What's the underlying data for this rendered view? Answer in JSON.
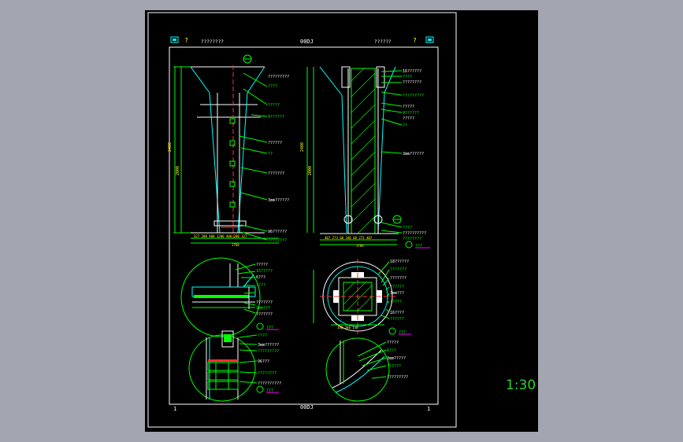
{
  "drawing": {
    "header_left_label": "????????",
    "header_code_top": "00DJ",
    "header_right_label": "??????",
    "header_q_left": "?",
    "header_q_right": "?",
    "footer_code": "00DJ",
    "footer_left_num": "1",
    "footer_right_num": "1",
    "scale": "1:30",
    "views": [
      {
        "name": "front-elevation",
        "callouts": [
          "?????????",
          "????",
          "?????",
          "9??????",
          "??????",
          "??",
          "???????",
          "3mm??????",
          "96??????",
          "????????"
        ]
      },
      {
        "name": "section-elevation",
        "callouts": [
          "16??????",
          "????",
          "????????",
          "?????????",
          "?????",
          "9??????",
          "?????",
          "??",
          "3mm??????",
          "????",
          "??????????",
          "????????"
        ]
      },
      {
        "name": "detail-1",
        "callouts": [
          "?????",
          "15?????",
          "6???",
          "????",
          "???????",
          "3mm???",
          "???????"
        ]
      },
      {
        "name": "plan-section",
        "callouts": [
          "18??????",
          "???????",
          "???????",
          "??????",
          "3mm???",
          "?????",
          "16????",
          "??????"
        ]
      },
      {
        "name": "detail-3",
        "callouts": [
          "????",
          "3mm??????",
          "?????????",
          "96???",
          "????????",
          "??????????"
        ]
      },
      {
        "name": "detail-4",
        "callouts": [
          "?????",
          "6???",
          "3mm?????",
          "??????",
          "?????????"
        ]
      }
    ],
    "detail_tags": [
      "???",
      "???",
      "???",
      "???"
    ]
  }
}
